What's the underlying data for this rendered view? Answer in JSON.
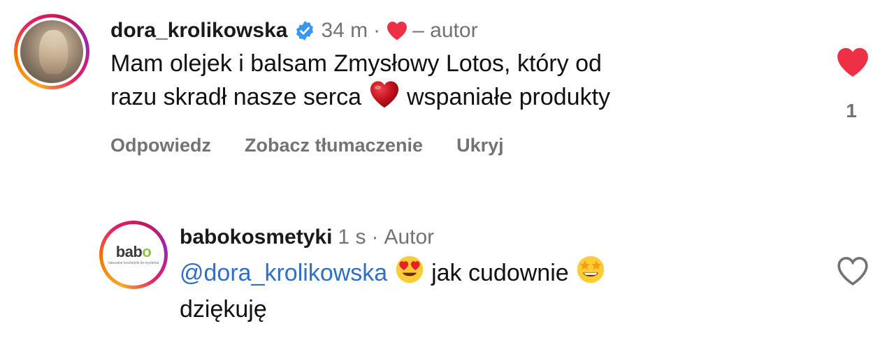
{
  "comments": [
    {
      "username": "dora_krolikowska",
      "verified": true,
      "time": "34 m",
      "separator": "·",
      "creator_liked": true,
      "author_label": "– autor",
      "text_line1": "Mam olejek i balsam Zmysłowy Lotos, który od",
      "text_line2_a": "razu skradł nasze serca",
      "text_line2_b": "wspaniałe produkty",
      "like_state": "liked",
      "like_count": "1",
      "actions": {
        "reply": "Odpowiedz",
        "translate": "Zobacz tłumaczenie",
        "hide": "Ukryj"
      }
    },
    {
      "username": "babokosmetyki",
      "time": "1 s",
      "separator": "·",
      "author_label": "Autor",
      "mention": "@dora_krolikowska",
      "text_a": "jak cudownie",
      "text_b": "dziękuję",
      "like_state": "not-liked",
      "avatar_logo_text": "babo",
      "avatar_logo_tagline": "naturalne kosmetyki do myślenia"
    }
  ],
  "colors": {
    "heart_red": "#ed3046",
    "verified_blue": "#3897f0",
    "muted_gray": "#737373",
    "mention_blue": "#2f6fc4",
    "babo_green": "#8cc63f"
  }
}
